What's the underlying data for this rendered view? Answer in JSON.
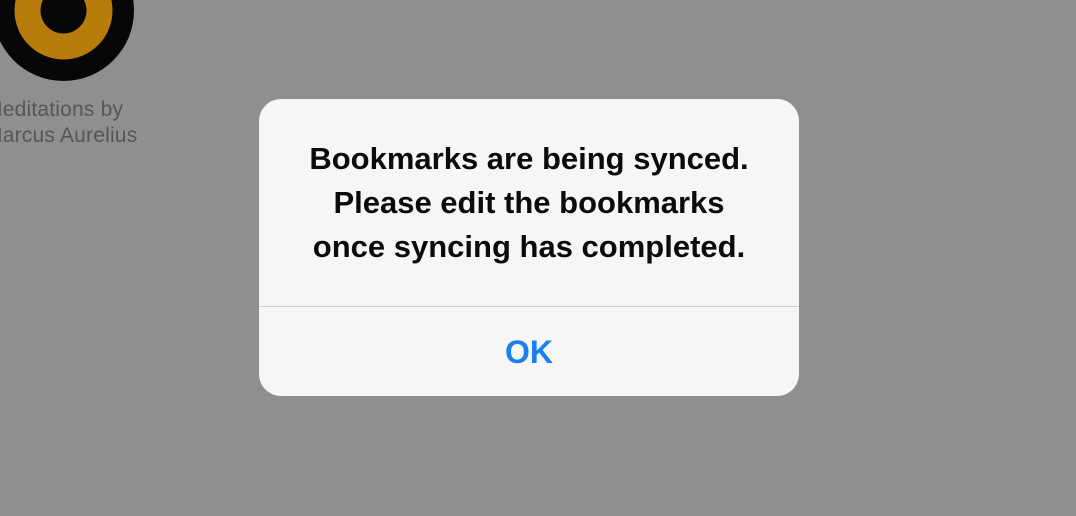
{
  "library": {
    "book": {
      "title_line1": "Meditations by",
      "title_line2": "Marcus Aurelius",
      "icon": "target-rings-icon",
      "colors": {
        "outer": "#070707",
        "ring": "#b87c0b",
        "center": "#070707"
      }
    }
  },
  "alert": {
    "message_line1": "Bookmarks are being synced.",
    "message_line2": "Please edit the bookmarks",
    "message_line3": "once syncing has completed.",
    "ok_label": "OK"
  },
  "colors": {
    "overlay": "#8f8f8f",
    "alert_background": "#f6f6f6",
    "button_text": "#1a7ff0"
  }
}
